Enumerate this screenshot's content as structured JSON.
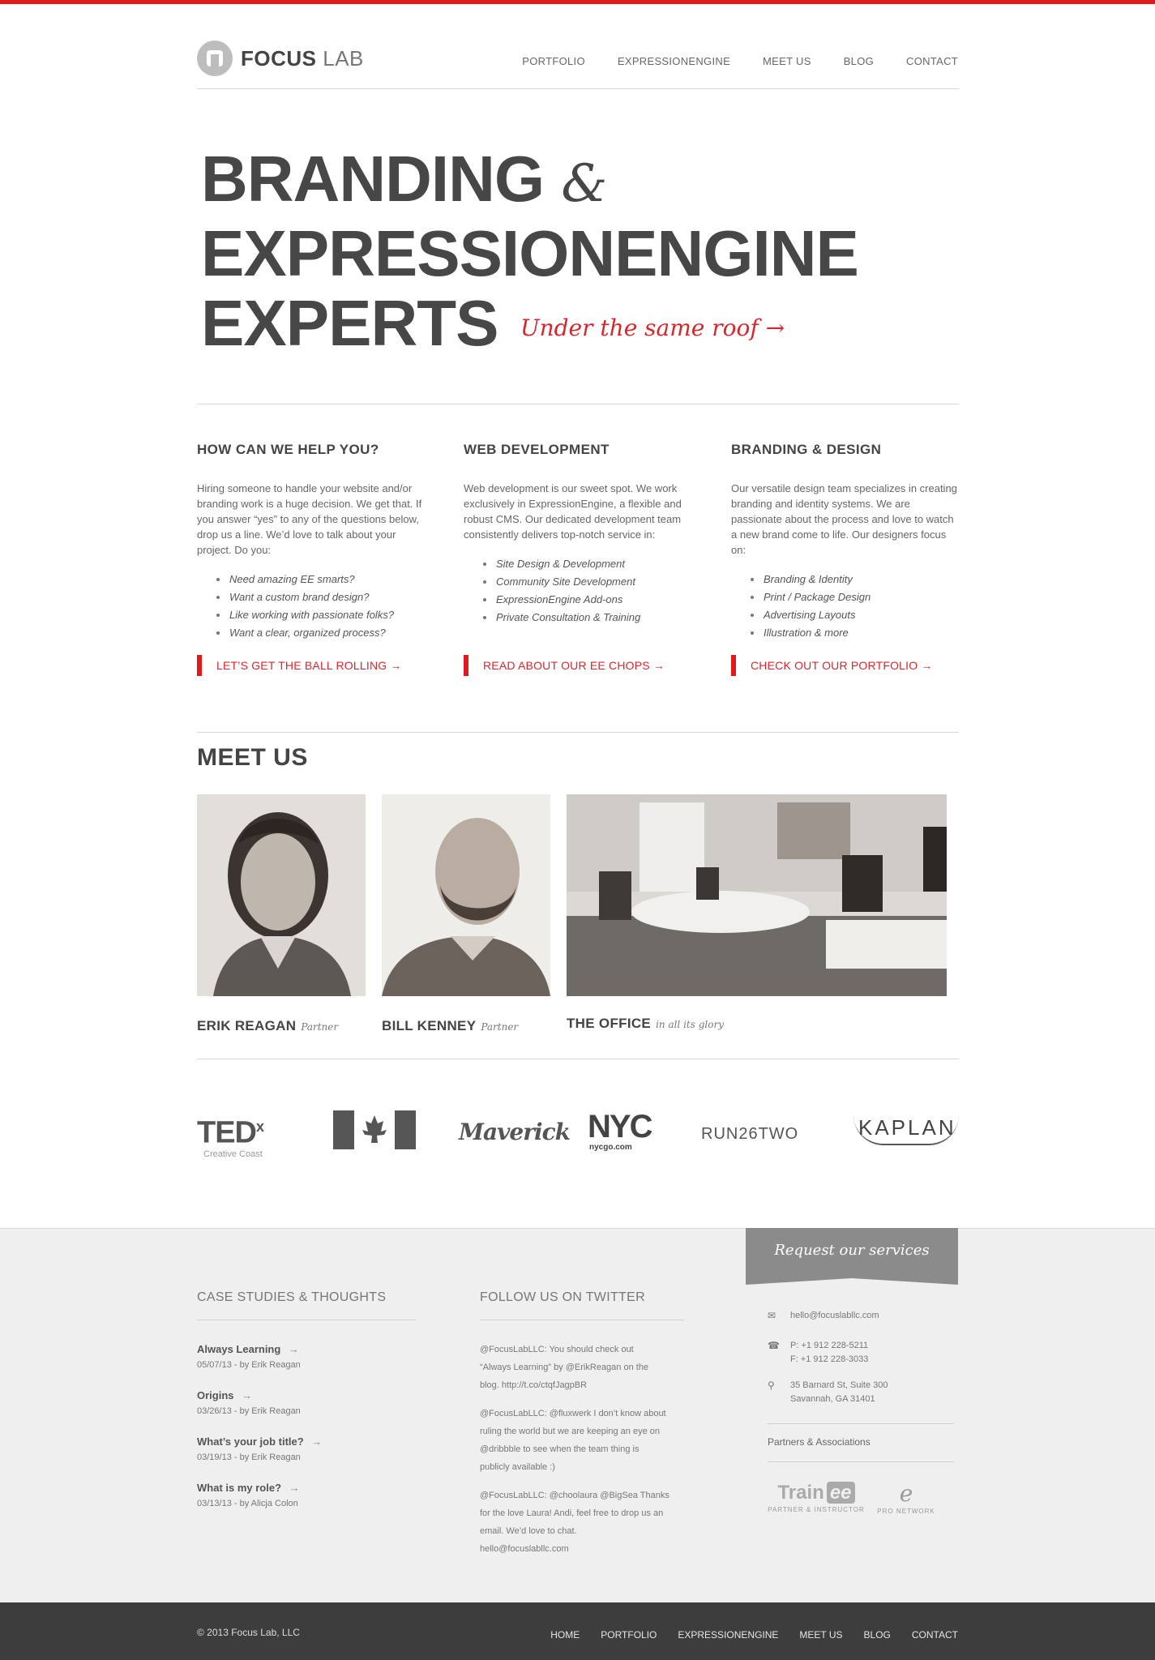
{
  "brand": {
    "logo_bold": "FOCUS",
    "logo_light": "LAB",
    "accent": "#e1191c"
  },
  "nav": [
    "PORTFOLIO",
    "EXPRESSIONENGINE",
    "MEET US",
    "BLOG",
    "CONTACT"
  ],
  "hero": {
    "line1": "BRANDING",
    "amp": "&",
    "line2": "EXPRESSIONENGINE",
    "line3": "EXPERTS",
    "tagline": "Under the same roof →"
  },
  "columns": [
    {
      "title": "HOW CAN WE HELP YOU?",
      "text": "Hiring someone to handle your website and/or branding work is a huge decision. We get that. If you answer “yes” to any of the questions below, drop us a line. We’d love to talk about your project. Do you:",
      "items": [
        "Need amazing EE smarts?",
        "Want a custom brand design?",
        "Like working with passionate folks?",
        "Want a clear, organized process?"
      ],
      "cta": "LET’S GET THE BALL ROLLING →"
    },
    {
      "title": "WEB DEVELOPMENT",
      "text": "Web development is our sweet spot. We work exclusively in ExpressionEngine, a flexible and robust CMS. Our dedicated development team consistently delivers top-notch service in:",
      "items": [
        "Site Design & Development",
        "Community Site Development",
        "ExpressionEngine Add-ons",
        "Private Consultation & Training"
      ],
      "cta": "READ ABOUT OUR EE CHOPS →"
    },
    {
      "title": "BRANDING & DESIGN",
      "text": "Our versatile design team specializes in creating branding and identity systems. We are passionate about the process and love to watch a new brand come to life. Our designers focus on:",
      "items": [
        "Branding & Identity",
        "Print / Package Design",
        "Advertising Layouts",
        "Illustration & more"
      ],
      "cta": "CHECK OUT OUR PORTFOLIO →"
    }
  ],
  "meet": {
    "title": "MEET US",
    "people": [
      {
        "name": "ERIK REAGAN",
        "role": "Partner"
      },
      {
        "name": "BILL KENNEY",
        "role": "Partner"
      },
      {
        "name": "THE OFFICE",
        "role": "in all its glory"
      }
    ]
  },
  "clients": {
    "ted": "TED",
    "ted_x": "x",
    "ted_sub": "Creative Coast",
    "maverick": "Maverick",
    "nyc": "NYC",
    "nyc_sub": "nycgo.com",
    "run": "RUN26TWO",
    "kaplan": "KAPLAN"
  },
  "footer": {
    "request": "Request our services",
    "case_title": "CASE STUDIES & THOUGHTS",
    "posts": [
      {
        "title": "Always Learning",
        "meta": "05/07/13 - by Erik Reagan"
      },
      {
        "title": "Origins",
        "meta": "03/26/13 - by Erik Reagan"
      },
      {
        "title": "What’s your job title?",
        "meta": "03/19/13 - by Erik Reagan"
      },
      {
        "title": "What is my role?",
        "meta": "03/13/13 - by Alicja Colon"
      }
    ],
    "twitter_title": "FOLLOW US ON TWITTER",
    "tweets": [
      {
        "t1": "@FocusLabLLC: You should check out",
        "t2": "“Always Learning” by @ErikReagan on the",
        "t3": "blog. http://t.co/ctqfJagpBR"
      },
      {
        "t1": "@FocusLabLLC: @fluxwerk I don’t know about",
        "t2": "ruling the world but we are keeping an eye on",
        "t3": "@dribbble to see when the team thing is",
        "t4": "publicly available :)"
      },
      {
        "t1": "@FocusLabLLC: @choolaura @BigSea Thanks",
        "t2": "for the love Laura! Andi, feel free to drop us an",
        "t3": "email. We’d love to chat.",
        "t4": "hello@focuslabllc.com"
      }
    ],
    "email": "hello@focuslabllc.com",
    "phone": "P: +1 912 228-5211",
    "fax": "F: +1 912 228-3033",
    "addr1": "35 Barnard St, Suite 300",
    "addr2": "Savannah, GA 31401",
    "partners_title": "Partners & Associations",
    "train_a": "Train",
    "train_b": "ee",
    "train_sub": "PARTNER & INSTRUCTOR",
    "pro_mark": "e",
    "pro_sub": "PRO NETWORK"
  },
  "bottom": {
    "copyright": "© 2013 Focus Lab, LLC",
    "nav": [
      "HOME",
      "PORTFOLIO",
      "EXPRESSIONENGINE",
      "MEET US",
      "BLOG",
      "CONTACT"
    ]
  }
}
